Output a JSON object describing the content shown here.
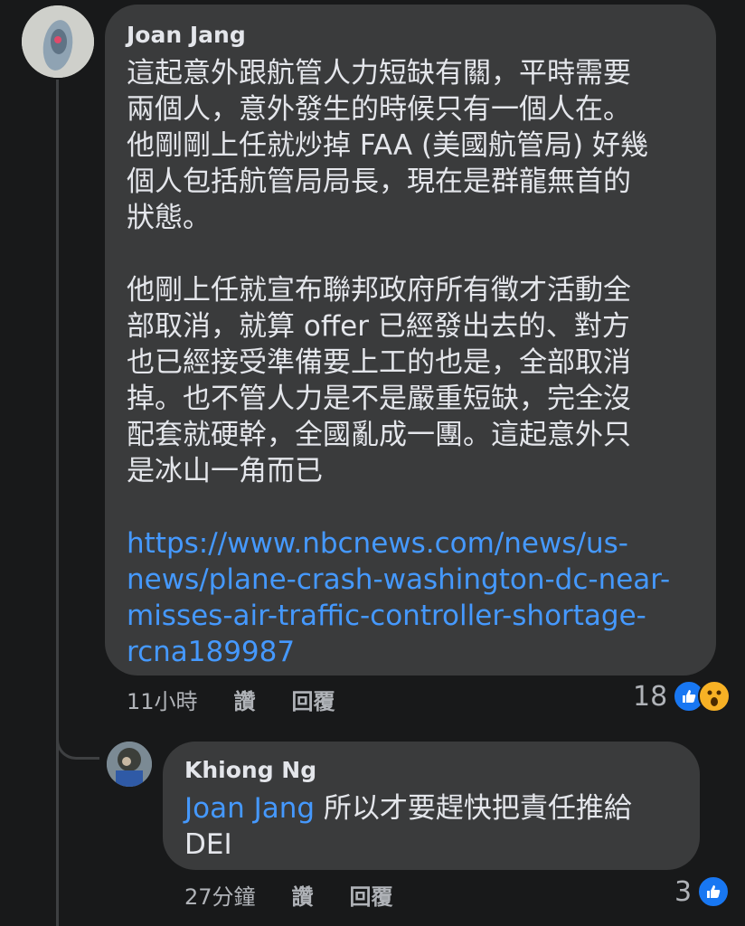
{
  "comment": {
    "author": "Joan Jang",
    "paragraph1": "這起意外跟航管人力短缺有關，平時需要\n兩個人，意外發生的時候只有一個人在。\n他剛剛上任就炒掉 FAA (美國航管局) 好幾\n個人包括航管局局長，現在是群龍無首的\n狀態。",
    "paragraph2": "他剛上任就宣布聯邦政府所有徵才活動全\n部取消，就算 offer 已經發出去的、對方\n也已經接受準備要上工的也是，全部取消\n掉。也不管人力是不是嚴重短缺，完全沒\n配套就硬幹，全國亂成一團。這起意外只\n是冰山一角而已",
    "link": "https://www.nbcnews.com/news/us-\nnews/plane-crash-washington-dc-near-\nmisses-air-traffic-controller-shortage-\nrcna189987",
    "time": "11小時",
    "like_label": "讚",
    "reply_label": "回覆",
    "reaction_count": "18",
    "reactions": [
      "like-icon",
      "wow-icon"
    ]
  },
  "reply": {
    "author": "Khiong Ng",
    "mention": "Joan Jang",
    "text": " 所以才要趕快把責任推給\nDEI",
    "time": "27分鐘",
    "like_label": "讚",
    "reply_label": "回覆",
    "reaction_count": "3",
    "reactions": [
      "like-icon"
    ]
  },
  "colors": {
    "background": "#18191a",
    "bubble": "#3a3b3c",
    "link": "#4599ff",
    "like": "#1877f2",
    "wow": "#f7b125"
  }
}
